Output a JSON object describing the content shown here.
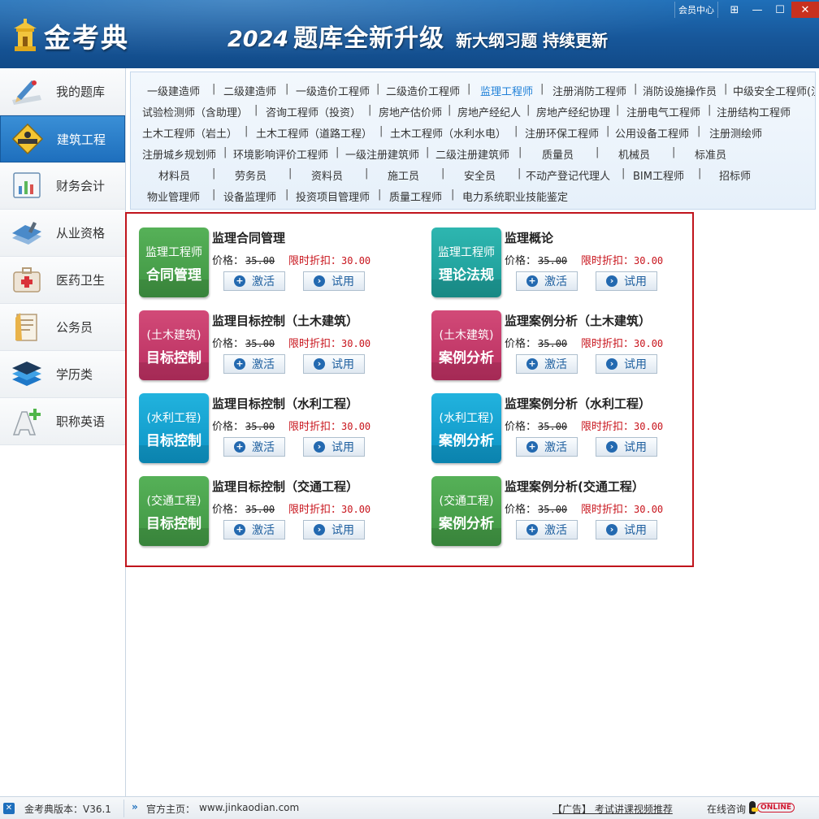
{
  "header": {
    "logo_text": "金考典",
    "banner_year": "2024",
    "banner_main": "题库全新升级",
    "banner_sub": "新大纲习题 持续更新",
    "member_center": "会员中心"
  },
  "sidebar": {
    "items": [
      {
        "label": "我的题库",
        "icon": "pencil-icon"
      },
      {
        "label": "建筑工程",
        "icon": "construction-sign-icon"
      },
      {
        "label": "财务会计",
        "icon": "chart-board-icon"
      },
      {
        "label": "从业资格",
        "icon": "book-stack-icon"
      },
      {
        "label": "医药卫生",
        "icon": "medical-kit-icon"
      },
      {
        "label": "公务员",
        "icon": "document-icon"
      },
      {
        "label": "学历类",
        "icon": "layers-icon"
      },
      {
        "label": "职称英语",
        "icon": "letter-a-plus-icon"
      }
    ],
    "active_index": 1
  },
  "categories": {
    "active": "监理工程师",
    "rows": [
      [
        "一级建造师",
        "二级建造师",
        "一级造价工程师",
        "二级造价工程师",
        "监理工程师",
        "注册消防工程师",
        "消防设施操作员",
        "中级安全工程师(注"
      ],
      [
        "试验检测师（含助理）",
        "咨询工程师（投资）",
        "房地产估价师",
        "房地产经纪人",
        "房地产经纪协理",
        "注册电气工程师",
        "注册结构工程师"
      ],
      [
        "土木工程师（岩土）",
        "土木工程师（道路工程）",
        "土木工程师（水利水电）",
        "注册环保工程师",
        "公用设备工程师",
        "注册测绘师"
      ],
      [
        "注册城乡规划师",
        "环境影响评价工程师",
        "一级注册建筑师",
        "二级注册建筑师",
        "质量员",
        "机械员",
        "标准员"
      ],
      [
        "材料员",
        "劳务员",
        "资料员",
        "施工员",
        "安全员",
        "不动产登记代理人",
        "BIM工程师",
        "招标师"
      ],
      [
        "物业管理师",
        "设备监理师",
        "投资项目管理师",
        "质量工程师",
        "电力系统职业技能鉴定"
      ]
    ]
  },
  "products": {
    "price_label": "价格：",
    "discount_label": "限时折扣：",
    "activate_label": "激活",
    "trial_label": "试用",
    "items": [
      {
        "tile_top": "监理工程师",
        "tile_bottom": "合同管理",
        "color": "#4ca64f",
        "title": "监理合同管理",
        "price": "35.00",
        "discount": "30.00"
      },
      {
        "tile_top": "监理工程师",
        "tile_bottom": "理论法规",
        "color": "#24aaa5",
        "title": "监理概论",
        "price": "35.00",
        "discount": "30.00"
      },
      {
        "tile_top": "(土木建筑)",
        "tile_bottom": "目标控制",
        "color": "#c63c6b",
        "title": "监理目标控制（土木建筑）",
        "price": "35.00",
        "discount": "30.00"
      },
      {
        "tile_top": "(土木建筑)",
        "tile_bottom": "案例分析",
        "color": "#c63c6b",
        "title": "监理案例分析（土木建筑）",
        "price": "35.00",
        "discount": "30.00"
      },
      {
        "tile_top": "(水利工程)",
        "tile_bottom": "目标控制",
        "color": "#17a3d1",
        "title": "监理目标控制（水利工程）",
        "price": "35.00",
        "discount": "30.00"
      },
      {
        "tile_top": "(水利工程)",
        "tile_bottom": "案例分析",
        "color": "#17a3d1",
        "title": "监理案例分析（水利工程）",
        "price": "35.00",
        "discount": "30.00"
      },
      {
        "tile_top": "(交通工程)",
        "tile_bottom": "目标控制",
        "color": "#4ca64f",
        "title": "监理目标控制（交通工程）",
        "price": "35.00",
        "discount": "30.00"
      },
      {
        "tile_top": "(交通工程)",
        "tile_bottom": "案例分析",
        "color": "#4ca64f",
        "title": "监理案例分析(交通工程）",
        "price": "35.00",
        "discount": "30.00"
      }
    ]
  },
  "footer": {
    "version": "金考典版本：V36.1",
    "home_label": "官方主页：",
    "home_url": "www.jinkaodian.com",
    "ad_text": "【广告】 考试讲课视频推荐",
    "consult": "在线咨询",
    "online": "ONLINE"
  }
}
